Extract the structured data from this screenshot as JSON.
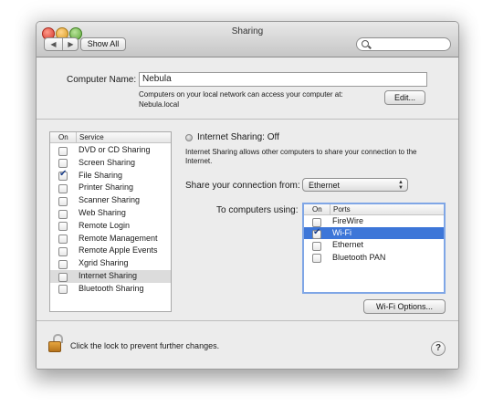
{
  "window": {
    "title": "Sharing"
  },
  "toolbar": {
    "back_glyph": "◀",
    "forward_glyph": "▶",
    "show_all_label": "Show All",
    "search_placeholder": ""
  },
  "computer_name": {
    "label": "Computer Name:",
    "value": "Nebula",
    "info_line1": "Computers on your local network can access your computer at:",
    "info_line2": "Nebula.local",
    "edit_label": "Edit..."
  },
  "services": {
    "header_on": "On",
    "header_service": "Service",
    "items": [
      {
        "label": "DVD or CD Sharing",
        "checked": false,
        "selected": false
      },
      {
        "label": "Screen Sharing",
        "checked": false,
        "selected": false
      },
      {
        "label": "File Sharing",
        "checked": true,
        "selected": false
      },
      {
        "label": "Printer Sharing",
        "checked": false,
        "selected": false
      },
      {
        "label": "Scanner Sharing",
        "checked": false,
        "selected": false
      },
      {
        "label": "Web Sharing",
        "checked": false,
        "selected": false
      },
      {
        "label": "Remote Login",
        "checked": false,
        "selected": false
      },
      {
        "label": "Remote Management",
        "checked": false,
        "selected": false
      },
      {
        "label": "Remote Apple Events",
        "checked": false,
        "selected": false
      },
      {
        "label": "Xgrid Sharing",
        "checked": false,
        "selected": false
      },
      {
        "label": "Internet Sharing",
        "checked": false,
        "selected": true
      },
      {
        "label": "Bluetooth Sharing",
        "checked": false,
        "selected": false
      }
    ]
  },
  "detail": {
    "status": "Internet Sharing: Off",
    "description_line1": "Internet Sharing allows other computers to share your connection to the",
    "description_line2": "Internet.",
    "share_from_label": "Share your connection from:",
    "share_from_value": "Ethernet",
    "to_computers_label": "To computers using:",
    "ports_header_on": "On",
    "ports_header_ports": "Ports",
    "ports": [
      {
        "label": "FireWire",
        "checked": false,
        "selected": false
      },
      {
        "label": "Wi-Fi",
        "checked": true,
        "selected": true
      },
      {
        "label": "Ethernet",
        "checked": false,
        "selected": false
      },
      {
        "label": "Bluetooth PAN",
        "checked": false,
        "selected": false
      }
    ],
    "wifi_options_label": "Wi-Fi Options..."
  },
  "footer": {
    "lock_text": "Click the lock to prevent further changes.",
    "help_glyph": "?"
  },
  "colors": {
    "selection_blue": "#3d76d8",
    "window_bg": "#ececec"
  }
}
